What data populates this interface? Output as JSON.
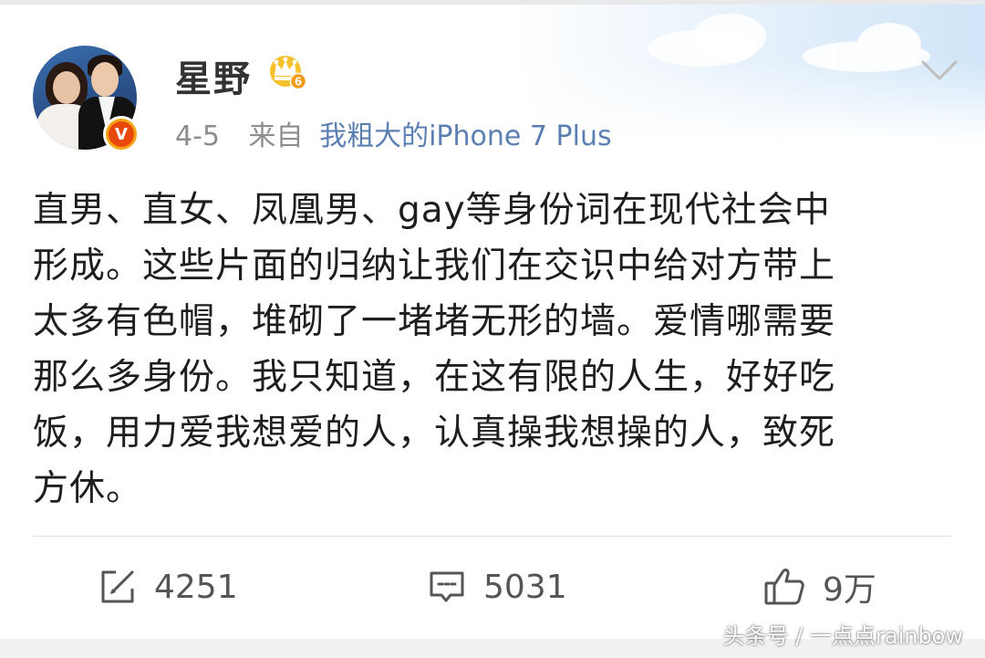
{
  "post": {
    "author": "星野",
    "author_level": "6",
    "verified_mark": "V",
    "date": "4-5",
    "from_label": "来自",
    "source": "我粗大的iPhone 7 Plus",
    "content": "直男、直女、凤凰男、gay等身份词在现代社会中\n形成。这些片面的归纳让我们在交识中给对方带上\n太多有色帽，堆砌了一堵堵无形的墙。爱情哪需要\n那么多身份。我只知道，在这有限的人生，好好吃\n饭，用力爱我想爱的人，认真操我想操的人，致死\n方休。"
  },
  "actions": {
    "repost_count": "4251",
    "comment_count": "5031",
    "like_count": "9万"
  },
  "watermark": "头条号 / 一点点rainbow",
  "icons": {
    "repost": "repost-icon",
    "comment": "comment-icon",
    "like": "thumbs-up-icon",
    "more": "chevron-down-icon",
    "crown": "crown-badge-icon"
  },
  "colors": {
    "link": "#5b7fb3",
    "meta_gray": "#8d8d8d",
    "text": "#1e1e1e",
    "badge_orange": "#f6a316"
  }
}
